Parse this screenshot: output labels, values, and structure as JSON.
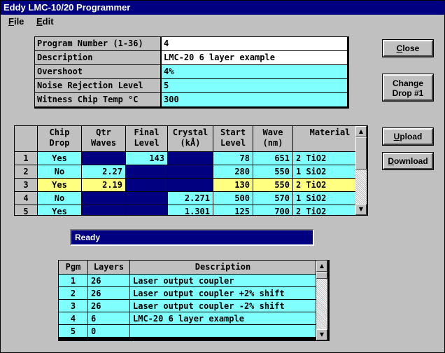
{
  "window": {
    "title": "Eddy LMC-10/20 Programmer"
  },
  "menu": {
    "file_rest": "ile",
    "file_acc": "F",
    "edit_rest": "dit",
    "edit_acc": "E"
  },
  "form": {
    "rows": [
      {
        "label": "Program Number (1-36)",
        "value": "4"
      },
      {
        "label": "Description",
        "value": "LMC-20 6 layer example"
      },
      {
        "label": "Overshoot",
        "value": "4%"
      },
      {
        "label": "Noise Rejection Level",
        "value": "5"
      },
      {
        "label": "Witness Chip Temp °C",
        "value": "300"
      }
    ]
  },
  "buttons": {
    "close_acc": "C",
    "close_rest": "lose",
    "change_line1": "Change",
    "change_line2": "Drop #1",
    "upload_acc": "U",
    "upload_rest": "pload",
    "download_acc": "D",
    "download_rest": "ownload"
  },
  "layers": {
    "headers": [
      "Chip\nDrop",
      "Qtr\nWaves",
      "Final\nLevel",
      "Crystal\n(kÅ)",
      "Start\nLevel",
      "Wave\n(nm)",
      "Material"
    ],
    "rows": [
      {
        "n": "1",
        "chip": "Yes",
        "qtr": "",
        "final": "143",
        "crystal": "",
        "start": "78",
        "wave": "651",
        "material": "2 TiO2"
      },
      {
        "n": "2",
        "chip": "No",
        "qtr": "2.27",
        "final": "",
        "crystal": "",
        "start": "280",
        "wave": "550",
        "material": "1 SiO2"
      },
      {
        "n": "3",
        "chip": "Yes",
        "qtr": "2.19",
        "final": "",
        "crystal": "",
        "start": "130",
        "wave": "550",
        "material": "2 TiO2"
      },
      {
        "n": "4",
        "chip": "No",
        "qtr": "",
        "final": "",
        "crystal": "2.271",
        "start": "500",
        "wave": "570",
        "material": "1 SiO2"
      },
      {
        "n": "5",
        "chip": "Yes",
        "qtr": "",
        "final": "",
        "crystal": "1.301",
        "start": "125",
        "wave": "700",
        "material": "2 TiO2"
      }
    ]
  },
  "status": {
    "text": "Ready"
  },
  "programs": {
    "headers": [
      "Pgm",
      "Layers",
      "Description"
    ],
    "rows": [
      {
        "pgm": "1",
        "layers": "26",
        "desc": "Laser output coupler"
      },
      {
        "pgm": "2",
        "layers": "26",
        "desc": "Laser output coupler +2% shift"
      },
      {
        "pgm": "3",
        "layers": "26",
        "desc": "Laser output coupler -2% shift"
      },
      {
        "pgm": "4",
        "layers": "6",
        "desc": "LMC-20 6 layer example"
      },
      {
        "pgm": "5",
        "layers": "0",
        "desc": ""
      }
    ]
  },
  "colors": {
    "cyan": "#80ffff",
    "yellow": "#ffff80",
    "navy": "#000080",
    "face": "#c0c0c0"
  },
  "icons": {
    "scroll_up": "arrow-up-icon",
    "scroll_down": "arrow-down-icon"
  }
}
